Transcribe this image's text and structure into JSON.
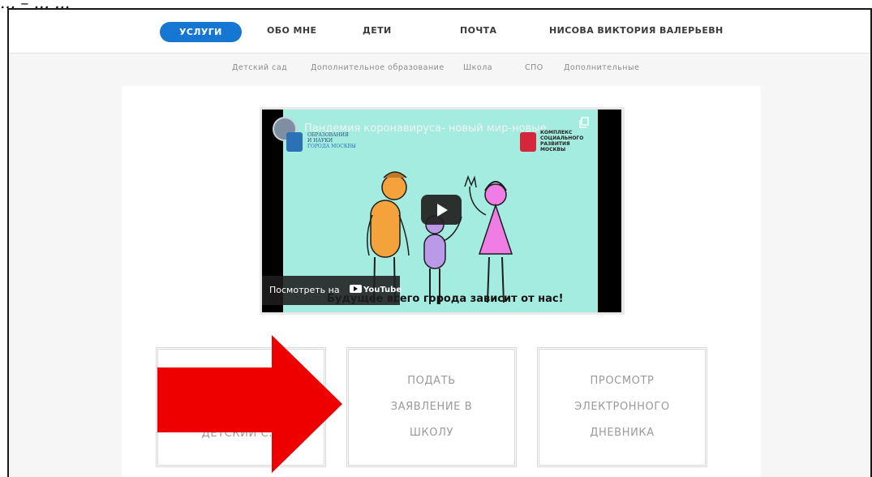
{
  "hint_text": "... – ... ...",
  "nav": {
    "items": [
      {
        "label": "УСЛУГИ",
        "active": true
      },
      {
        "label": "ОБО МНЕ",
        "active": false
      },
      {
        "label": "ДЕТИ",
        "active": false
      },
      {
        "label": "ПОЧТА",
        "active": false
      },
      {
        "label": "НИСОВА ВИКТОРИЯ ВАЛЕРЬЕВН",
        "active": false
      }
    ]
  },
  "subnav": {
    "items": [
      "Детский сад",
      "Дополнительное образование",
      "Школа",
      "СПО",
      "Дополнительные"
    ]
  },
  "video": {
    "title": "Пандемия коронавируса- новый мир-новые...",
    "logo_left_lines": [
      "ОБРАЗОВАНИЯ",
      "И НАУКИ",
      "ГОРОДА МОСКВЫ"
    ],
    "logo_right_lines": [
      "КОМПЛЕКС",
      "СОЦИАЛЬНОГО",
      "РАЗВИТИЯ",
      "МОСКВЫ"
    ],
    "watch_on_label": "Посмотреть на",
    "youtube_label": "YouTube",
    "caption": "Будущее всего города зависит от нас!"
  },
  "cards": [
    {
      "lines": [
        "ДЕТСКИЙ С..."
      ]
    },
    {
      "lines": [
        "ПОДАТЬ",
        "ЗАЯВЛЕНИЕ В",
        "ШКОЛУ"
      ]
    },
    {
      "lines": [
        "ПРОСМОТР",
        "ЭЛЕКТРОННОГО",
        "ДНЕВНИКА"
      ]
    }
  ],
  "colors": {
    "accent": "#1677d2",
    "arrow": "#ee0000",
    "video_bg": "#a4ece0"
  },
  "icons": [
    "copy-icon",
    "play-icon",
    "youtube-icon",
    "arrow-pointer"
  ]
}
